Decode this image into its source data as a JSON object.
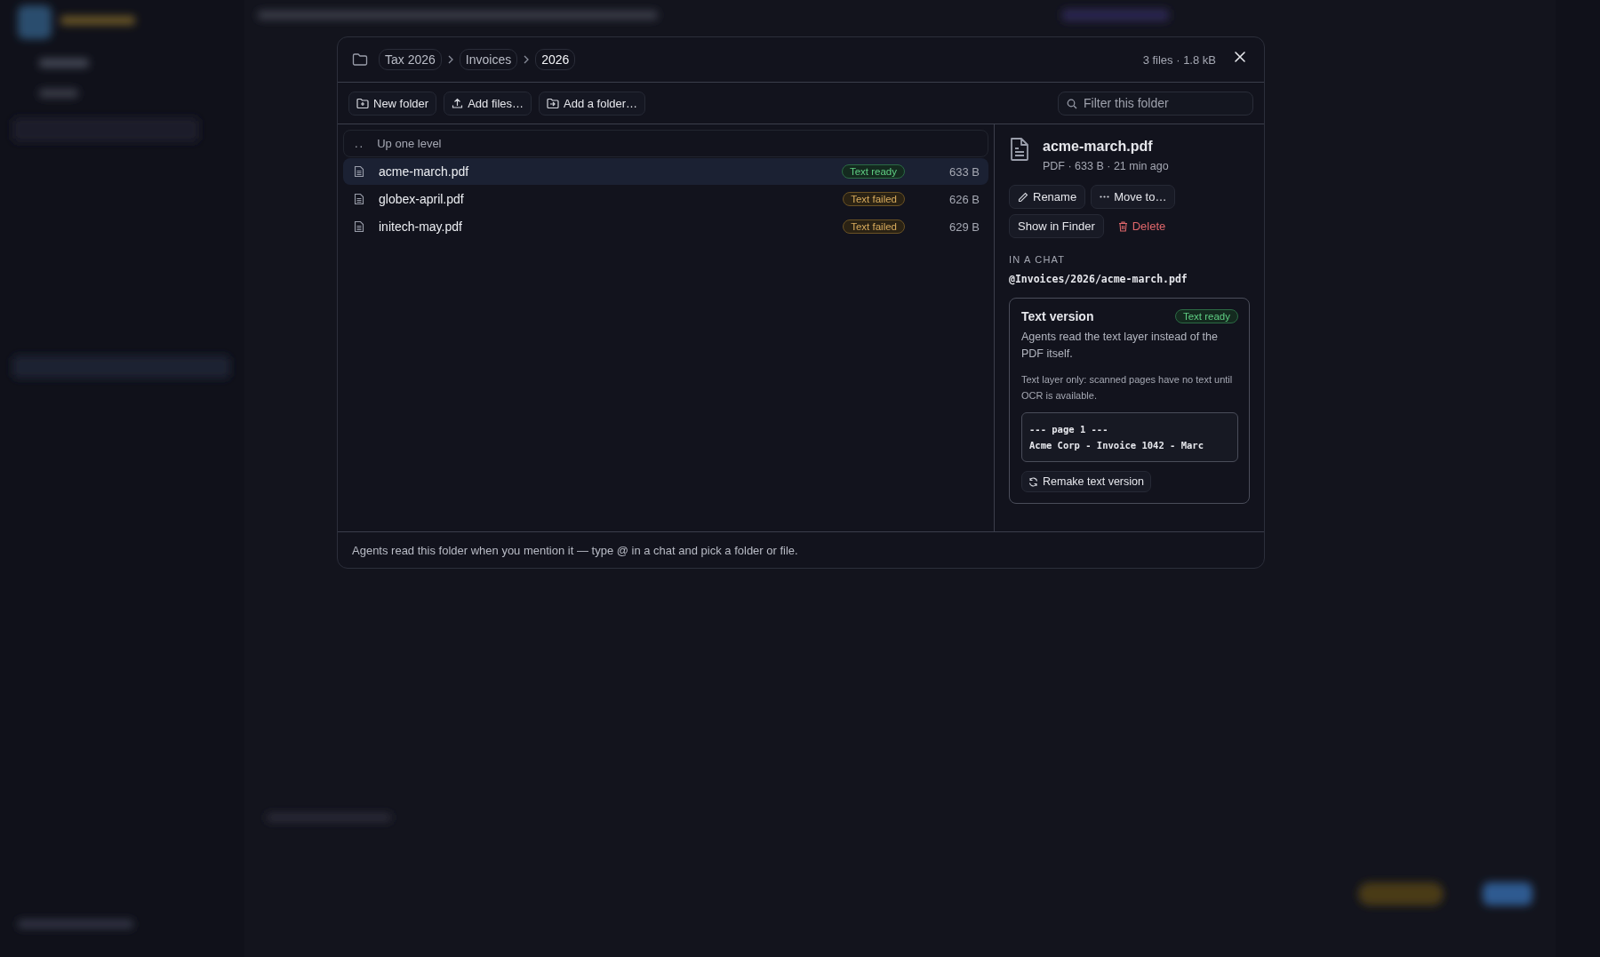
{
  "breadcrumb": [
    {
      "label": "Tax 2026",
      "selected": false
    },
    {
      "label": "Invoices",
      "selected": false
    },
    {
      "label": "2026",
      "selected": true
    }
  ],
  "summary": "3 files · 1.8 kB",
  "toolbar": {
    "buttons": [
      {
        "label": "New folder",
        "kind": "new-folder"
      },
      {
        "label": "Add files…",
        "kind": "upload"
      },
      {
        "label": "Add a folder…",
        "kind": "add-folder"
      }
    ],
    "filter": {
      "placeholder": "Filter this folder"
    }
  },
  "up_row": {
    "marker": "..",
    "label": "Up one level"
  },
  "files": [
    {
      "name": "acme-march.pdf",
      "status": "Text ready",
      "kind": "ready",
      "size": "633 B",
      "selected": true
    },
    {
      "name": "globex-april.pdf",
      "status": "Text failed",
      "kind": "failed",
      "size": "626 B",
      "selected": false
    },
    {
      "name": "initech-may.pdf",
      "status": "Text failed",
      "kind": "failed",
      "size": "629 B",
      "selected": false
    }
  ],
  "detail": {
    "name": "acme-march.pdf",
    "meta": "PDF · 633 B · 21 min ago",
    "actions": [
      {
        "label": "Rename",
        "kind": "rename"
      },
      {
        "label": "Move to…",
        "kind": "move"
      },
      {
        "label": "Show in Finder",
        "kind": "finder"
      },
      {
        "label": "Delete",
        "kind": "delete"
      }
    ],
    "chat_heading": "IN A CHAT",
    "chat_ref": "@Invoices/2026/acme-march.pdf",
    "text_version": {
      "title": "Text version",
      "status": "Text ready",
      "kind": "ready",
      "description": "Agents read the text layer instead of the PDF itself.",
      "note": "Text layer only: scanned pages have no text until OCR is available.",
      "preview": [
        "--- page 1 ---",
        "Acme Corp - Invoice 1042 - Marc"
      ],
      "remake": "Remake text version"
    }
  },
  "footer": "Agents read this folder when you mention it — type @ in a chat and pick a folder or file."
}
